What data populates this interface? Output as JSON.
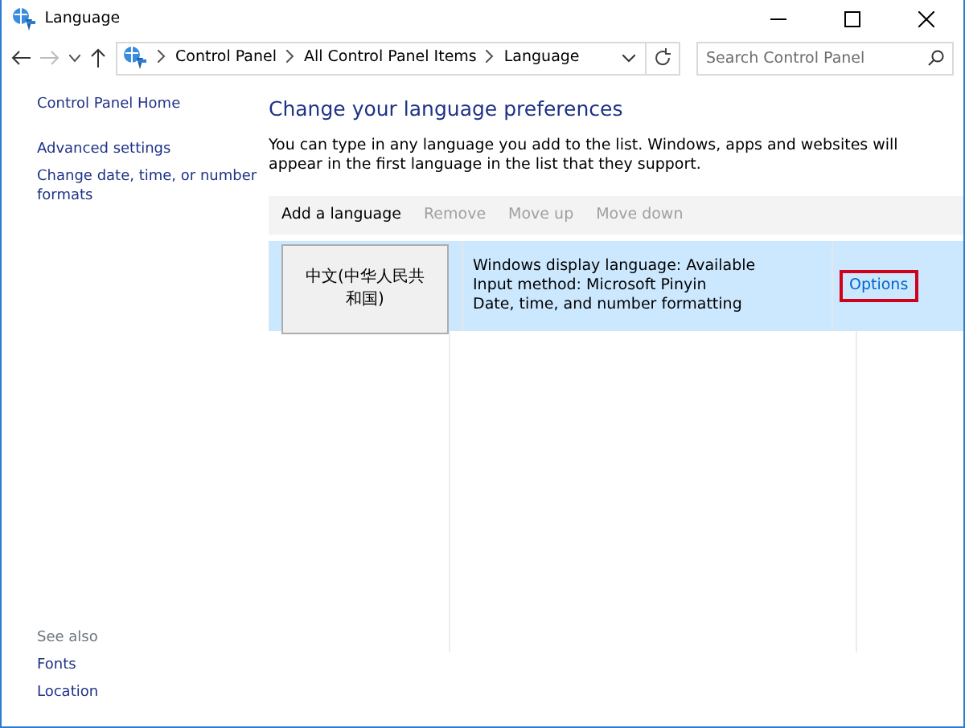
{
  "window": {
    "title": "Language"
  },
  "address": {
    "crumbs": [
      "Control Panel",
      "All Control Panel Items",
      "Language"
    ],
    "search_placeholder": "Search Control Panel"
  },
  "sidebar": {
    "items": [
      {
        "label": "Control Panel Home"
      },
      {
        "label": "Advanced settings"
      },
      {
        "label": "Change date, time, or number formats"
      }
    ],
    "see_also": {
      "heading": "See also",
      "links": [
        "Fonts",
        "Location"
      ]
    }
  },
  "main": {
    "heading": "Change your language preferences",
    "description": "You can type in any language you add to the list. Windows, apps and websites will appear in the first language in the list that they support.",
    "toolbar": [
      {
        "label": "Add a language",
        "disabled": false
      },
      {
        "label": "Remove",
        "disabled": true
      },
      {
        "label": "Move up",
        "disabled": true
      },
      {
        "label": "Move down",
        "disabled": true
      }
    ],
    "languages": [
      {
        "name": "中文(中华人民共和国)",
        "details": [
          "Windows display language: Available",
          "Input method: Microsoft Pinyin",
          "Date, time, and number formatting"
        ],
        "selected": true,
        "action": "Options",
        "highlighted": true
      }
    ]
  }
}
